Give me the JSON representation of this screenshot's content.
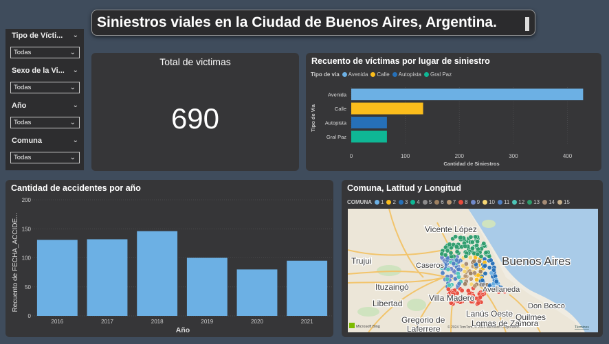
{
  "title": "Siniestros viales en la Ciudad de Buenos Aires, Argentina.",
  "slicers": [
    {
      "label": "Tipo de Vícti...",
      "value": "Todas"
    },
    {
      "label": "Sexo de la Vi...",
      "value": "Todas"
    },
    {
      "label": "Año",
      "value": "Todas"
    },
    {
      "label": "Comuna",
      "value": "Todas"
    }
  ],
  "kpi": {
    "title": "Total de victimas",
    "value": "690"
  },
  "bar_lugar": {
    "title": "Recuento de víctimas por lugar de siniestro",
    "legend_title": "Tipo de via"
  },
  "bar_anio": {
    "title": "Cantidad de accidentes por año"
  },
  "map": {
    "title": "Comuna, Latitud y Longitud",
    "legend_title": "COMUNA",
    "comunas": [
      {
        "name": "1",
        "color": "#6cb0e4"
      },
      {
        "name": "2",
        "color": "#fbbd1c"
      },
      {
        "name": "3",
        "color": "#2670b8"
      },
      {
        "name": "4",
        "color": "#0fb795"
      },
      {
        "name": "5",
        "color": "#8d8c8c"
      },
      {
        "name": "6",
        "color": "#9e8060"
      },
      {
        "name": "7",
        "color": "#b99771"
      },
      {
        "name": "8",
        "color": "#e84c3d"
      },
      {
        "name": "9",
        "color": "#6f88c9"
      },
      {
        "name": "10",
        "color": "#f7d774"
      },
      {
        "name": "11",
        "color": "#4f80c4"
      },
      {
        "name": "12",
        "color": "#4dc5b8"
      },
      {
        "name": "13",
        "color": "#2d9c6c"
      },
      {
        "name": "14",
        "color": "#a48b76"
      },
      {
        "name": "15",
        "color": "#c7b08b"
      }
    ],
    "places": [
      "Vicente López",
      "Buenos Aires",
      "Trujui",
      "Caseros",
      "Ituzaingó",
      "Libertad",
      "Villa Madero",
      "Avellaneda",
      "Don Bosco",
      "Lanús Oeste",
      "Gregorio de Laferrere",
      "Lomas de Zamora",
      "Quilmes"
    ],
    "copyright": "© 2024 TomTom, © 2024 Microsoft Corporation",
    "terms": "Términos",
    "bing": "Microsoft Bing"
  },
  "chart_data": [
    {
      "type": "bar",
      "orientation": "horizontal",
      "title": "Recuento de víctimas por lugar de siniestro",
      "xlabel": "Cantidad de Siniestros",
      "ylabel": "Tipo de Via",
      "legend_title": "Tipo de via",
      "legend_position": "top-left",
      "categories": [
        "Avenida",
        "Calle",
        "Autopista",
        "Gral Paz"
      ],
      "values": [
        429,
        133,
        66,
        66
      ],
      "colors": [
        "#6cb0e4",
        "#fbbd1c",
        "#2670b8",
        "#0fb795"
      ],
      "xticks": [
        0,
        100,
        200,
        300,
        400
      ],
      "xlim": [
        0,
        440
      ]
    },
    {
      "type": "bar",
      "title": "Cantidad de accidentes por año",
      "xlabel": "Año",
      "ylabel": "Recuento de FECHA_ACCIDE...",
      "categories": [
        "2016",
        "2017",
        "2018",
        "2019",
        "2020",
        "2021"
      ],
      "values": [
        131,
        132,
        146,
        100,
        80,
        95
      ],
      "color": "#6cb0e4",
      "yticks": [
        0,
        50,
        100,
        150,
        200
      ],
      "ylim": [
        0,
        200
      ]
    }
  ]
}
